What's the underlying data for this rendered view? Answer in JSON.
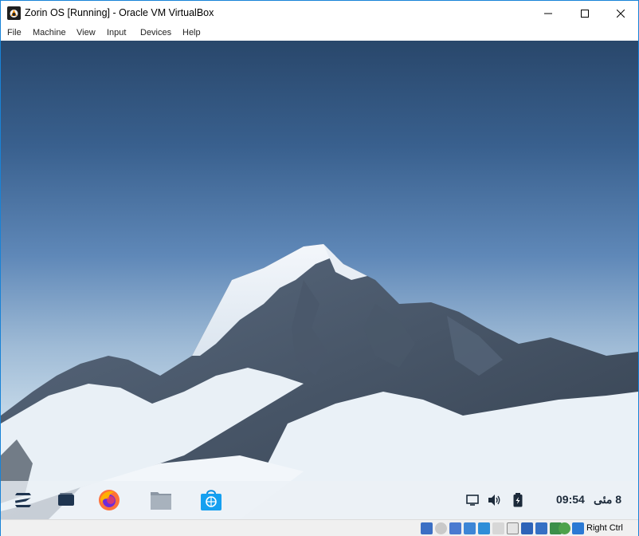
{
  "window": {
    "title": "Zorin OS [Running] - Oracle VM VirtualBox"
  },
  "menubar": {
    "items": [
      "File",
      "Machine",
      "View",
      "Input",
      "Devices",
      "Help"
    ]
  },
  "taskbar": {
    "apps": [
      {
        "icon": "zorin-menu-icon"
      },
      {
        "icon": "workspace-switcher-icon"
      },
      {
        "icon": "firefox-icon"
      },
      {
        "icon": "files-icon"
      },
      {
        "icon": "software-store-icon"
      }
    ],
    "tray": [
      {
        "icon": "display-icon"
      },
      {
        "icon": "volume-icon"
      },
      {
        "icon": "battery-icon"
      }
    ],
    "clock_time": "09:54",
    "clock_date": "8 مئی"
  },
  "statusbar": {
    "host_key": "Right Ctrl",
    "icons": [
      "hard-disk-icon",
      "optical-drive-icon",
      "audio-icon",
      "network-icon",
      "usb-icon",
      "shared-folders-icon",
      "display-icon",
      "video-capture-icon",
      "recording-icon",
      "cpu-icon",
      "guest-additions-icon",
      "mouse-integration-icon"
    ]
  }
}
